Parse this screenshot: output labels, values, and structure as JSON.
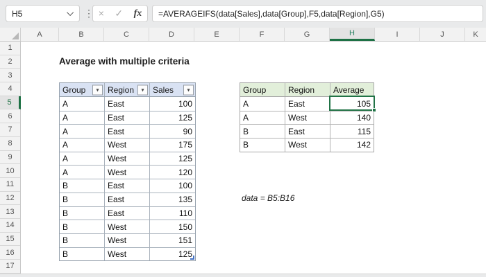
{
  "formula_bar": {
    "cell_reference": "H5",
    "formula": "=AVERAGEIFS(data[Sales],data[Group],F5,data[Region],G5)",
    "fx_label": "fx",
    "cancel_glyph": "×",
    "enter_glyph": "✓"
  },
  "columns": {
    "labels": [
      "A",
      "B",
      "C",
      "D",
      "E",
      "F",
      "G",
      "H",
      "I",
      "J",
      "K"
    ],
    "selected": "H"
  },
  "rows": {
    "labels": [
      "1",
      "2",
      "3",
      "4",
      "5",
      "6",
      "7",
      "8",
      "9",
      "10",
      "11",
      "12",
      "13",
      "14",
      "15",
      "16",
      "17"
    ],
    "selected": "5"
  },
  "sheet": {
    "title": "Average with multiple criteria",
    "note": "data = B5:B16"
  },
  "data_table": {
    "headers": [
      "Group",
      "Region",
      "Sales"
    ],
    "filter_glyph": "▾",
    "rows": [
      [
        "A",
        "East",
        "100"
      ],
      [
        "A",
        "East",
        "125"
      ],
      [
        "A",
        "East",
        "90"
      ],
      [
        "A",
        "West",
        "175"
      ],
      [
        "A",
        "West",
        "125"
      ],
      [
        "A",
        "West",
        "120"
      ],
      [
        "B",
        "East",
        "100"
      ],
      [
        "B",
        "East",
        "135"
      ],
      [
        "B",
        "East",
        "110"
      ],
      [
        "B",
        "West",
        "150"
      ],
      [
        "B",
        "West",
        "151"
      ],
      [
        "B",
        "West",
        "125"
      ]
    ]
  },
  "result_table": {
    "headers": [
      "Group",
      "Region",
      "Average"
    ],
    "selected_cell": "H5",
    "rows": [
      [
        "A",
        "East",
        "105"
      ],
      [
        "A",
        "West",
        "140"
      ],
      [
        "B",
        "East",
        "115"
      ],
      [
        "B",
        "West",
        "142"
      ]
    ]
  },
  "colors": {
    "selection_green": "#217346",
    "data_table_header_bg": "#D9E1F2",
    "result_table_header_bg": "#E2EFDA",
    "header_bg": "#F2F2F2",
    "formula_bar_bg": "#E9EAEB"
  }
}
